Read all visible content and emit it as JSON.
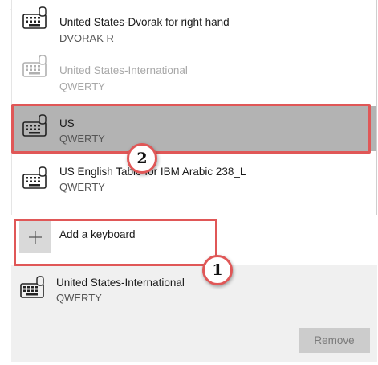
{
  "keyboard_list": [
    {
      "name": "United States-Dvorak for right hand",
      "layout": "DVORAK R",
      "state": "normal"
    },
    {
      "name": "United States-International",
      "layout": "QWERTY",
      "state": "disabled"
    },
    {
      "name": "US",
      "layout": "QWERTY",
      "state": "selected"
    },
    {
      "name": "US English Table for IBM Arabic 238_L",
      "layout": "QWERTY",
      "state": "normal"
    }
  ],
  "add_keyboard": {
    "label": "Add a keyboard"
  },
  "installed_keyboard": {
    "name": "United States-International",
    "layout": "QWERTY"
  },
  "remove_button": {
    "label": "Remove"
  },
  "callouts": [
    {
      "number": "1"
    },
    {
      "number": "2"
    }
  ],
  "colors": {
    "highlight": "#e05757",
    "selected_bg": "#b3b3b3",
    "panel_bg": "#f0f0f0"
  },
  "icons": {
    "back": "back-arrow-icon",
    "keyboard": "keyboard-icon",
    "add": "plus-icon"
  }
}
